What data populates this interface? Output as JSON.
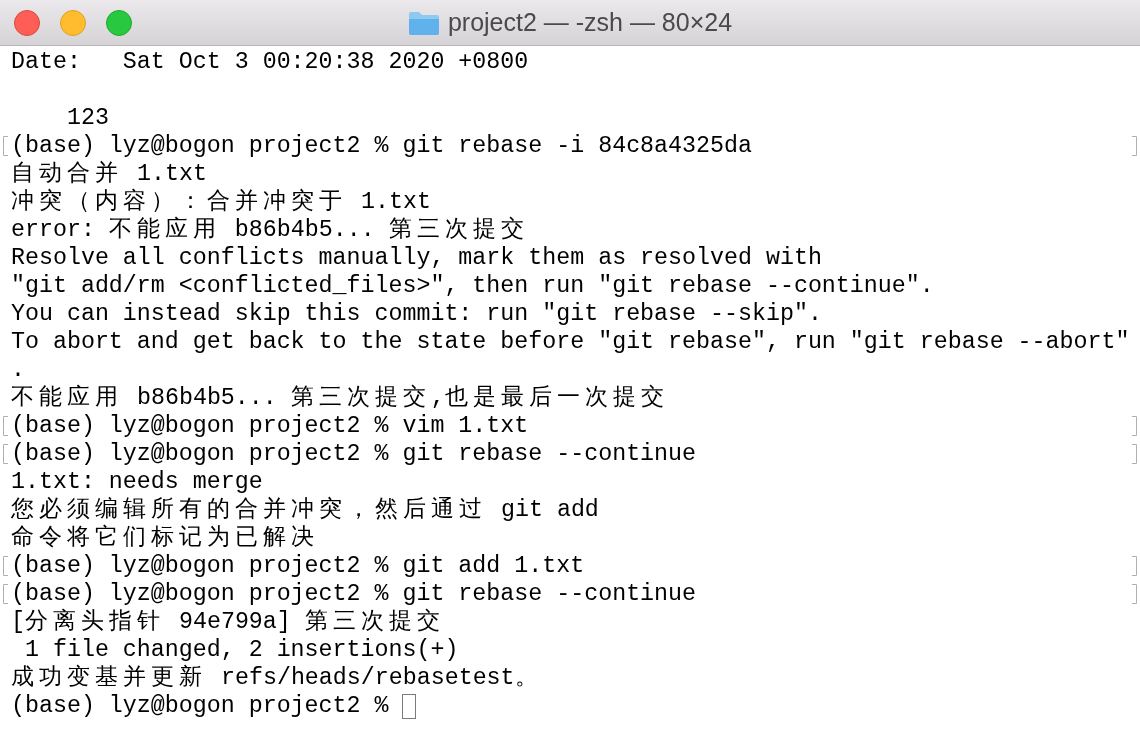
{
  "window": {
    "title": "project2 — -zsh — 80×24"
  },
  "lines": [
    {
      "kind": "output",
      "text": "Date:   Sat Oct 3 00:20:38 2020 +0800"
    },
    {
      "kind": "blank"
    },
    {
      "kind": "output",
      "text": "    123"
    },
    {
      "kind": "prompt",
      "marked": true,
      "text": "(base) lyz@bogon project2 % git rebase -i 84c8a4325da"
    },
    {
      "kind": "output",
      "text": "自动合并 1.txt"
    },
    {
      "kind": "output",
      "text": "冲突（内容）：合并冲突于 1.txt"
    },
    {
      "kind": "output",
      "text": "error: 不能应用 b86b4b5... 第三次提交"
    },
    {
      "kind": "output",
      "text": "Resolve all conflicts manually, mark them as resolved with"
    },
    {
      "kind": "output",
      "text": "\"git add/rm <conflicted_files>\", then run \"git rebase --continue\"."
    },
    {
      "kind": "output",
      "text": "You can instead skip this commit: run \"git rebase --skip\"."
    },
    {
      "kind": "output",
      "text": "To abort and get back to the state before \"git rebase\", run \"git rebase --abort\""
    },
    {
      "kind": "output",
      "text": "."
    },
    {
      "kind": "output",
      "text": "不能应用 b86b4b5... 第三次提交,也是最后一次提交"
    },
    {
      "kind": "prompt",
      "marked": true,
      "text": "(base) lyz@bogon project2 % vim 1.txt"
    },
    {
      "kind": "prompt",
      "marked": true,
      "text": "(base) lyz@bogon project2 % git rebase --continue"
    },
    {
      "kind": "output",
      "text": "1.txt: needs merge"
    },
    {
      "kind": "output",
      "text": "您必须编辑所有的合并冲突，然后通过 git add"
    },
    {
      "kind": "output",
      "text": "命令将它们标记为已解决"
    },
    {
      "kind": "prompt",
      "marked": true,
      "text": "(base) lyz@bogon project2 % git add 1.txt"
    },
    {
      "kind": "prompt",
      "marked": true,
      "text": "(base) lyz@bogon project2 % git rebase --continue"
    },
    {
      "kind": "output",
      "text": "[分离头指针 94e799a] 第三次提交"
    },
    {
      "kind": "output",
      "text": " 1 file changed, 2 insertions(+)"
    },
    {
      "kind": "output",
      "text": "成功变基并更新 refs/heads/rebasetest。"
    },
    {
      "kind": "prompt",
      "marked": false,
      "cursor": true,
      "text": "(base) lyz@bogon project2 %"
    }
  ]
}
